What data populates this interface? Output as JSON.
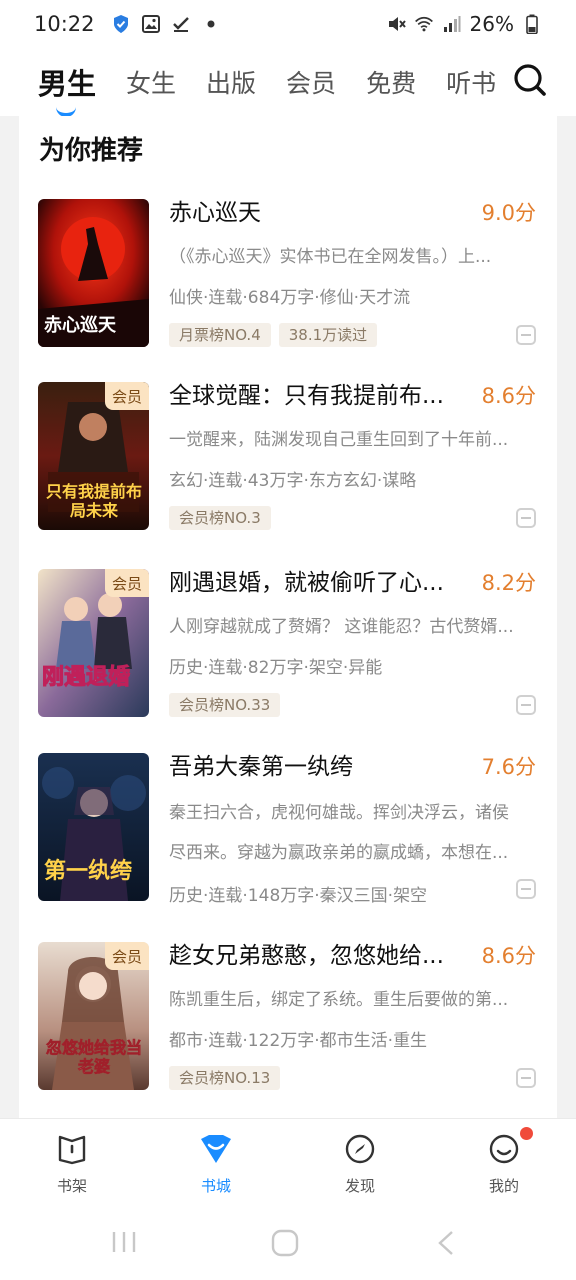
{
  "status_bar": {
    "time": "10:22",
    "battery": "26%",
    "icons": [
      "shield-icon",
      "gallery-icon",
      "check-icon",
      "dot-icon",
      "mute-icon",
      "wifi-icon",
      "signal-icon",
      "battery-icon"
    ]
  },
  "top_tabs": [
    {
      "label": "男生",
      "active": true
    },
    {
      "label": "女生",
      "active": false
    },
    {
      "label": "出版",
      "active": false
    },
    {
      "label": "会员",
      "active": false
    },
    {
      "label": "免费",
      "active": false
    },
    {
      "label": "听书",
      "active": false
    }
  ],
  "section": {
    "title": "为你推荐"
  },
  "books": [
    {
      "title": "赤心巡天",
      "score": "9.0分",
      "vip": false,
      "desc": "（《赤心巡天》实体书已在全网发售。）上...",
      "meta": "仙侠·连载·684万字·修仙·天才流",
      "tags": [
        "月票榜NO.4",
        "38.1万读过"
      ],
      "cover_text": "赤心巡天"
    },
    {
      "title": "全球觉醒：只有我提前布...",
      "score": "8.6分",
      "vip": true,
      "vip_label": "会员",
      "desc": "一觉醒来，陆渊发现自己重生回到了十年前...",
      "meta": "玄幻·连载·43万字·东方玄幻·谋略",
      "tags": [
        "会员榜NO.3"
      ],
      "cover_text": "只有我提前布局未来"
    },
    {
      "title": "刚遇退婚，就被偷听了心...",
      "score": "8.2分",
      "vip": true,
      "vip_label": "会员",
      "desc": "人刚穿越就成了赘婿？ 这谁能忍？古代赘婿...",
      "meta": "历史·连载·82万字·架空·异能",
      "tags": [
        "会员榜NO.33"
      ],
      "cover_text": "刚遇退婚"
    },
    {
      "title": "吾弟大秦第一纨绔",
      "score": "7.6分",
      "vip": false,
      "desc_line1": "秦王扫六合，虎视何雄哉。挥剑决浮云，诸侯",
      "desc_line2": "尽西来。穿越为嬴政亲弟的嬴成蟜，本想在...",
      "meta": "历史·连载·148万字·秦汉三国·架空",
      "tags": [],
      "cover_text": "第一纨绔"
    },
    {
      "title": "趁女兄弟憨憨，忽悠她给...",
      "score": "8.6分",
      "vip": true,
      "vip_label": "会员",
      "desc": "陈凯重生后，绑定了系统。重生后要做的第...",
      "meta": "都市·连载·122万字·都市生活·重生",
      "tags": [
        "会员榜NO.13"
      ],
      "cover_text": "忽悠她给我当老婆"
    }
  ],
  "bottom_nav": [
    {
      "label": "书架",
      "icon": "bookshelf-icon",
      "active": false
    },
    {
      "label": "书城",
      "icon": "bookstore-icon",
      "active": true
    },
    {
      "label": "发现",
      "icon": "compass-icon",
      "active": false
    },
    {
      "label": "我的",
      "icon": "profile-icon",
      "active": false
    }
  ],
  "colors": {
    "accent": "#1a8cff",
    "score": "#e37f2f",
    "badge": "#fbe3c2",
    "notification": "#f04a3a"
  }
}
